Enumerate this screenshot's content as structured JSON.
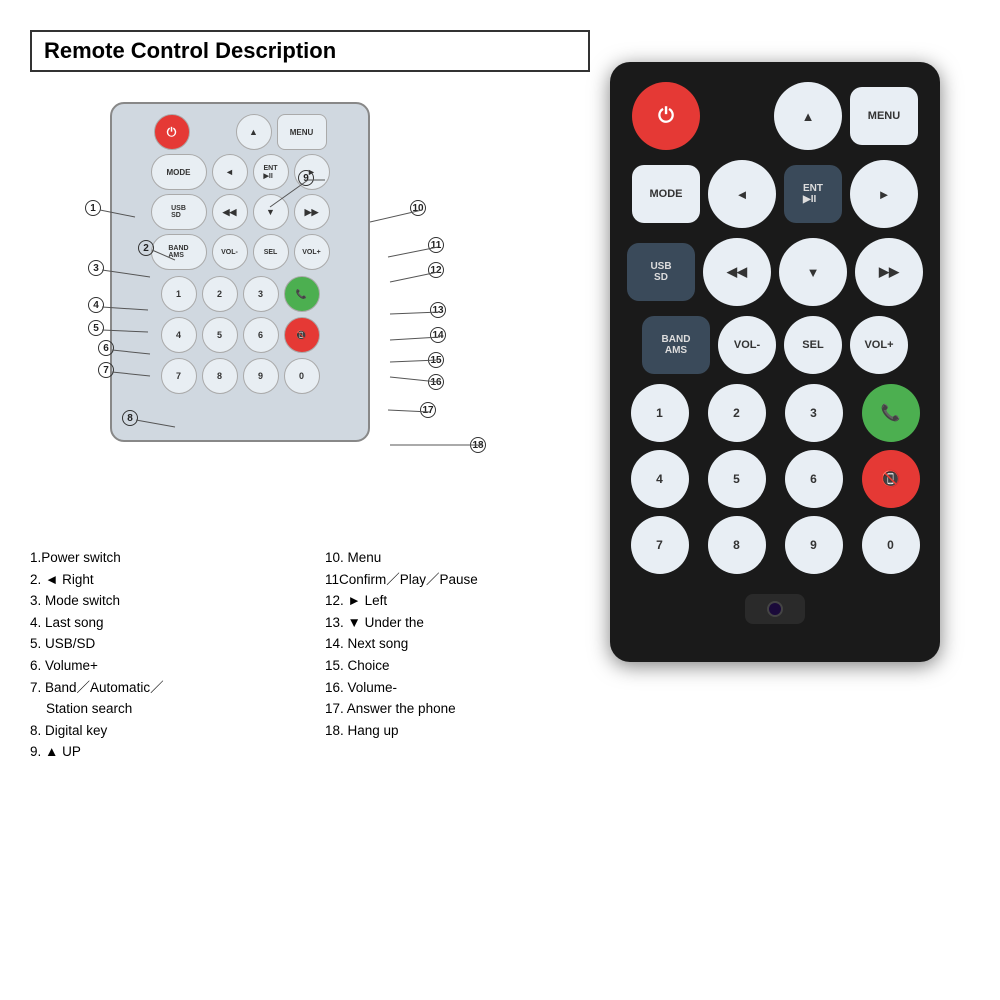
{
  "title": "Remote Control Description",
  "legend": {
    "left_col": [
      {
        "num": "1",
        "text": "1.Power switch"
      },
      {
        "num": "2",
        "text": "2. ◄ Right"
      },
      {
        "num": "3",
        "text": "3. Mode switch"
      },
      {
        "num": "4",
        "text": "4. Last song"
      },
      {
        "num": "5",
        "text": "5. USB/SD"
      },
      {
        "num": "6",
        "text": "6. Volume+"
      },
      {
        "num": "7",
        "text": "7. Band／Automatic／"
      },
      {
        "num": "7b",
        "text": "   Station search"
      },
      {
        "num": "8",
        "text": "8. Digital key"
      },
      {
        "num": "9",
        "text": "9. ▲ UP"
      }
    ],
    "right_col": [
      {
        "num": "10",
        "text": "10. Menu"
      },
      {
        "num": "11",
        "text": "11Confirm／Play／Pause"
      },
      {
        "num": "12",
        "text": "12. ► Left"
      },
      {
        "num": "13",
        "text": "13. ▼ Under the"
      },
      {
        "num": "14",
        "text": "14. Next song"
      },
      {
        "num": "15",
        "text": "15. Choice"
      },
      {
        "num": "16",
        "text": "16. Volume-"
      },
      {
        "num": "17",
        "text": "17. Answer the phone"
      },
      {
        "num": "18",
        "text": "18. Hang up"
      }
    ]
  },
  "diagram": {
    "buttons": {
      "row1": [
        "⏻",
        "▲",
        "MENU"
      ],
      "row2": [
        "MODE",
        "◄",
        "ENT ▶II",
        "►"
      ],
      "row3": [
        "USB SD",
        "◀◀",
        "▼",
        "▶▶"
      ],
      "row4": [
        "BAND AMS",
        "VOL-",
        "SEL",
        "VOL+"
      ],
      "numpad": [
        "1",
        "2",
        "3",
        "📞",
        "4",
        "5",
        "6",
        "📵",
        "7",
        "8",
        "9",
        "0"
      ]
    }
  },
  "callouts": [
    {
      "n": "①",
      "label": "1"
    },
    {
      "n": "②",
      "label": "2"
    },
    {
      "n": "③",
      "label": "3"
    },
    {
      "n": "④",
      "label": "4"
    },
    {
      "n": "⑤",
      "label": "5"
    },
    {
      "n": "⑥",
      "label": "6"
    },
    {
      "n": "⑦",
      "label": "7"
    },
    {
      "n": "⑧",
      "label": "8"
    },
    {
      "n": "⑨",
      "label": "9"
    },
    {
      "n": "⑩",
      "label": "10"
    },
    {
      "n": "⑪",
      "label": "11"
    },
    {
      "n": "⑫",
      "label": "12"
    },
    {
      "n": "⑬",
      "label": "13"
    },
    {
      "n": "⑭",
      "label": "14"
    },
    {
      "n": "⑮",
      "label": "15"
    },
    {
      "n": "⑯",
      "label": "16"
    },
    {
      "n": "⑰",
      "label": "17"
    },
    {
      "n": "⑱",
      "label": "18"
    }
  ]
}
